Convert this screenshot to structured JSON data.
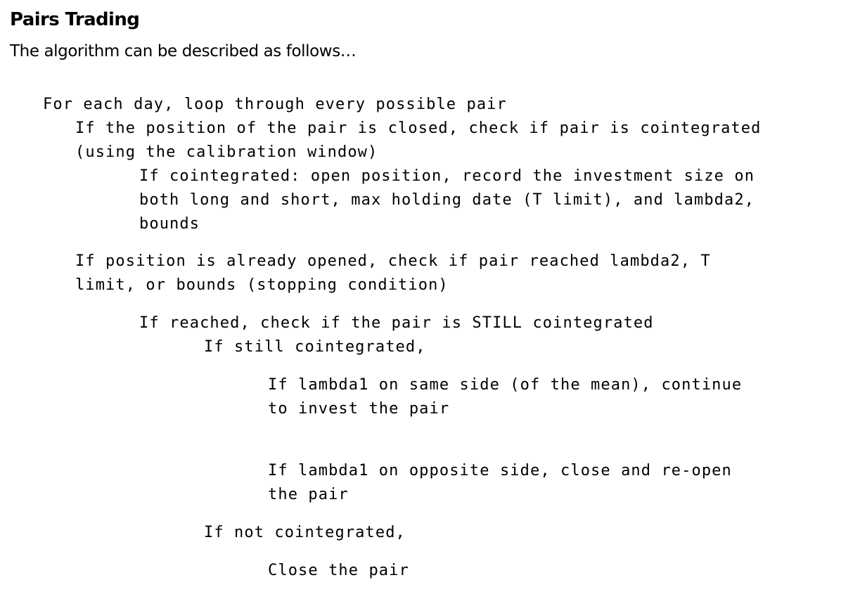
{
  "title": "Pairs Trading",
  "intro": "The algorithm can be described as follows…",
  "algorithm": [
    "For each day, loop through every possible pair",
    "If the position of the pair is closed, check if pair is cointegrated",
    "(using the calibration window)",
    "If cointegrated: open position, record the investment size on",
    "both long and short, max holding date (T limit), and lambda2,",
    "bounds",
    "If position is already opened, check if pair reached lambda2, T",
    "limit, or bounds (stopping condition)",
    "If reached, check if the pair is STILL cointegrated",
    "If still cointegrated,",
    "If lambda1 on same side (of the mean), continue",
    "to invest the pair",
    "If lambda1 on opposite side, close and re-open",
    "the pair",
    "If not cointegrated,",
    "Close the pair"
  ]
}
